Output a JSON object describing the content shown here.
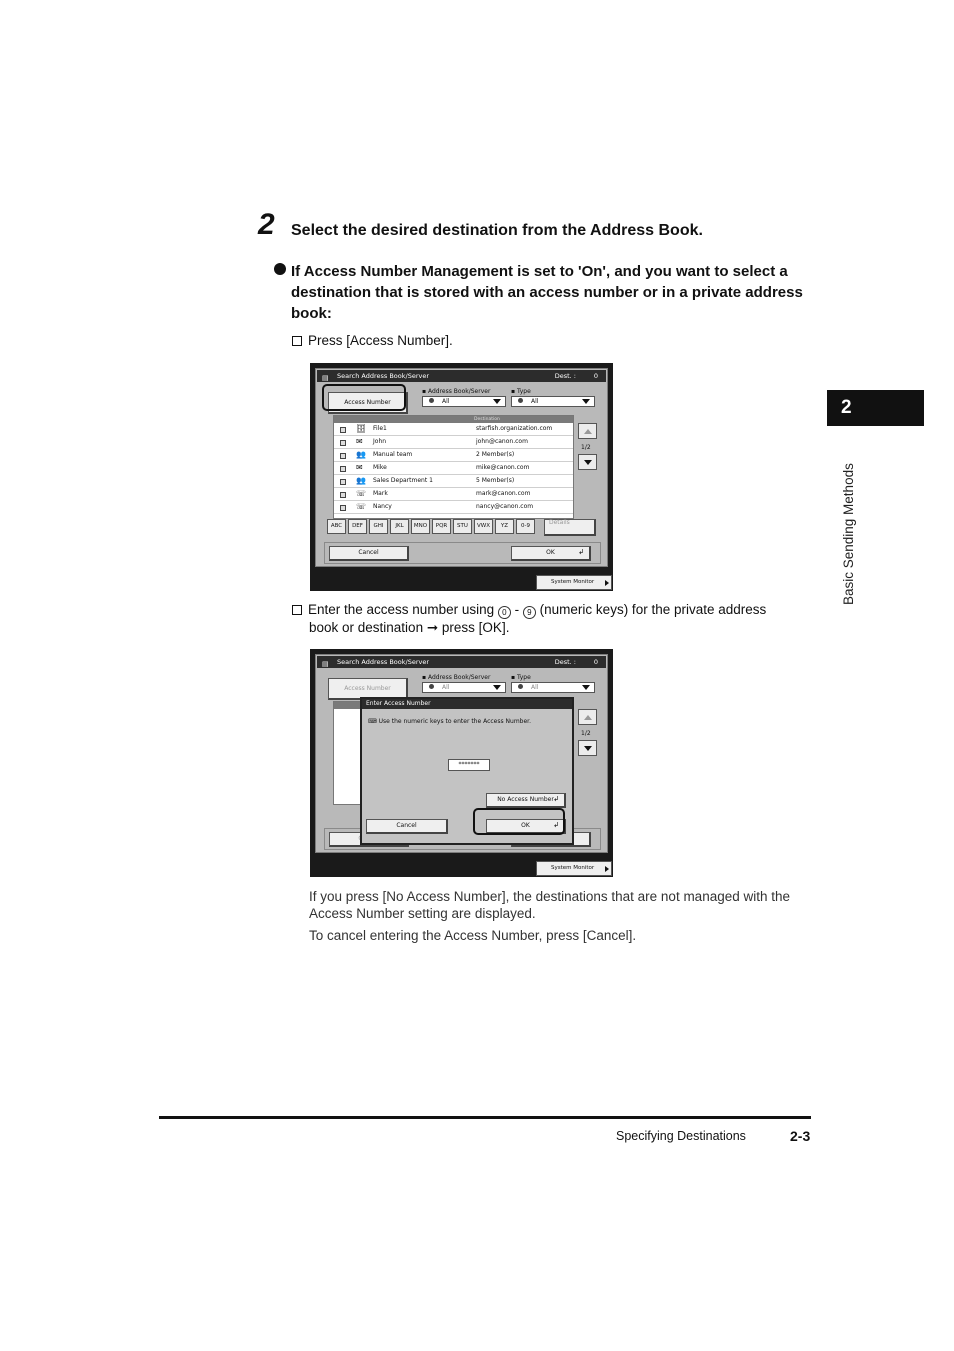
{
  "step": {
    "number": "2",
    "title": "Select the desired destination from the Address Book."
  },
  "bullet": "If Access Number Management is set to 'On', and you want to select a destination that is stored with an access number or in a private address book:",
  "substep1": "Press [Access Number].",
  "substep2": {
    "part1": "Enter the access number using",
    "key_from": "0",
    "sep": "-",
    "key_to": "9",
    "part2": "(numeric keys) for the private address",
    "part3": "book or destination",
    "arrow": "➞",
    "part4": "press [OK]."
  },
  "note1": "If you press [No Access Number], the destinations that are not managed with the Access Number setting are displayed.",
  "note2": "To cancel entering the Access Number, press [Cancel].",
  "chapter": {
    "number": "2",
    "title": "Basic Sending Methods"
  },
  "footer": {
    "section": "Specifying Destinations",
    "page": "2-3"
  },
  "screen": {
    "title": "Search Address Book/Server",
    "dest_label": "Dest. :",
    "dest_count": "0",
    "access_number": "Access Number",
    "address_book_label": "Address Book/Server",
    "type_label": "Type",
    "address_book_value": "All",
    "type_value": "All",
    "destination_header": "Destination",
    "rows": [
      {
        "name": "File1",
        "addr": "starfish.organization.com",
        "icon": "🗄"
      },
      {
        "name": "John",
        "addr": "john@canon.com",
        "icon": "✉"
      },
      {
        "name": "Manual team",
        "addr": "2 Member(s)",
        "icon": "👥"
      },
      {
        "name": "Mike",
        "addr": "mike@canon.com",
        "icon": "✉"
      },
      {
        "name": "Sales Department 1",
        "addr": "5 Member(s)",
        "icon": "👥"
      },
      {
        "name": "Mark",
        "addr": "mark@canon.com",
        "icon": "☏"
      },
      {
        "name": "Nancy",
        "addr": "nancy@canon.com",
        "icon": "☏"
      }
    ],
    "page": "1/2",
    "alpha_keys": [
      "ABC",
      "DEF",
      "GHI",
      "JKL",
      "MNO",
      "PQR",
      "STU",
      "VWX",
      "YZ",
      "0-9"
    ],
    "details": "Details",
    "cancel": "Cancel",
    "ok": "OK",
    "system_monitor": "System Monitor"
  },
  "dialog": {
    "title": "Enter Access Number",
    "message": "Use the numeric keys to enter the Access Number.",
    "value": "*******",
    "no_access": "No Access Number",
    "cancel": "Cancel",
    "ok": "OK"
  }
}
